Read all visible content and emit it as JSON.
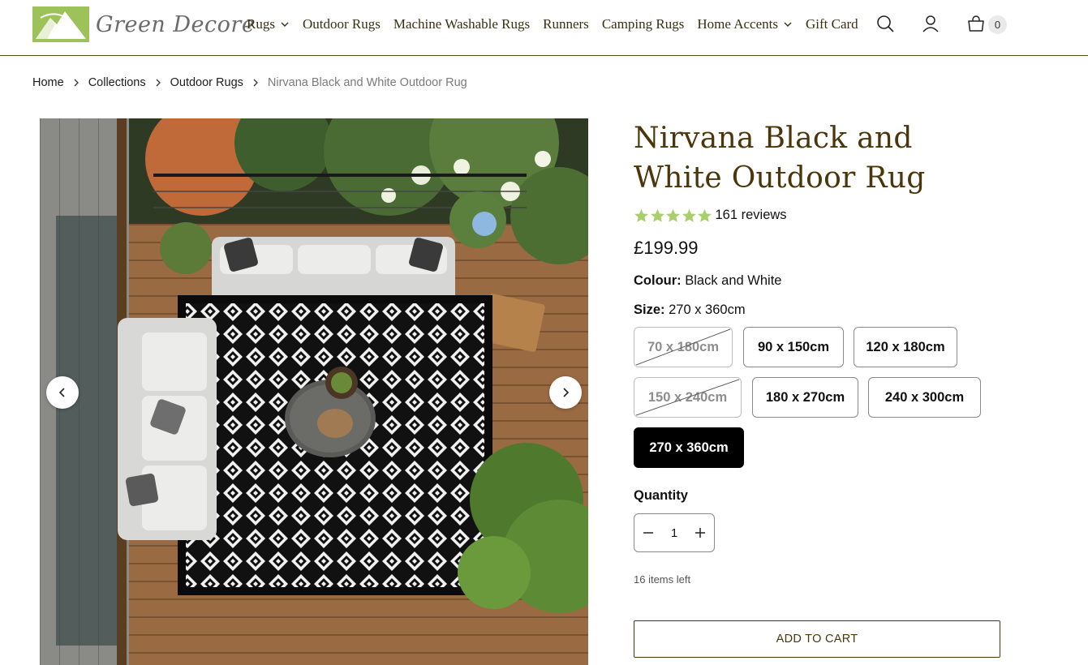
{
  "brand": {
    "name": "Green Decore",
    "accent": "#9dc25a",
    "title_color": "#4b360b"
  },
  "nav": {
    "items": [
      {
        "label": "Rugs",
        "has_dropdown": true
      },
      {
        "label": "Outdoor Rugs",
        "has_dropdown": false
      },
      {
        "label": "Machine Washable Rugs",
        "has_dropdown": false
      },
      {
        "label": "Runners",
        "has_dropdown": false
      },
      {
        "label": "Camping Rugs",
        "has_dropdown": false
      },
      {
        "label": "Home Accents",
        "has_dropdown": true
      },
      {
        "label": "Gift Card",
        "has_dropdown": false
      }
    ],
    "icons": [
      "search-icon",
      "account-icon",
      "cart-icon"
    ],
    "cart_count": "0"
  },
  "breadcrumb": {
    "items": [
      "Home",
      "Collections",
      "Outdoor Rugs"
    ],
    "current": "Nirvana Black and White Outdoor Rug"
  },
  "product": {
    "title": "Nirvana Black and White Outdoor Rug",
    "rating": 5,
    "reviews_text": "161 reviews",
    "price": "£199.99",
    "colour_label": "Colour:",
    "colour_value": "Black and White",
    "size_label": "Size:",
    "size_value": "270 x 360cm",
    "sizes": [
      {
        "label": "70 x 180cm",
        "available": false,
        "selected": false
      },
      {
        "label": "90 x 150cm",
        "available": true,
        "selected": false
      },
      {
        "label": "120 x 180cm",
        "available": true,
        "selected": false
      },
      {
        "label": "150 x 240cm",
        "available": false,
        "selected": false
      },
      {
        "label": "180 x 270cm",
        "available": true,
        "selected": false
      },
      {
        "label": "240 x 300cm",
        "available": true,
        "selected": false
      },
      {
        "label": "270 x 360cm",
        "available": true,
        "selected": true
      }
    ],
    "quantity_label": "Quantity",
    "quantity": "1",
    "stock_text": "16 items left",
    "add_to_cart": "ADD TO CART",
    "star_color": "#a8cf6c"
  }
}
